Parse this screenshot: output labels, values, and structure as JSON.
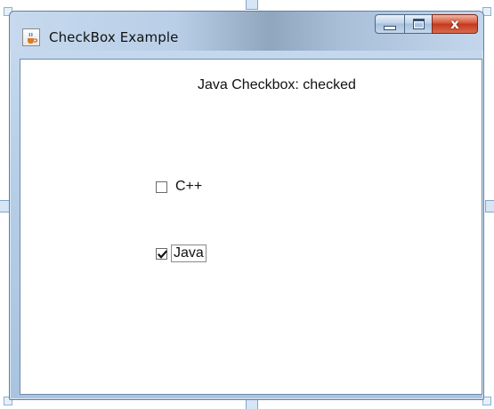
{
  "window": {
    "title": "CheckBox Example",
    "minimize_label": "",
    "maximize_label": "",
    "close_label": "x"
  },
  "status": {
    "text": "Java Checkbox: checked"
  },
  "checkboxes": [
    {
      "label": "C++",
      "checked": false
    },
    {
      "label": "Java",
      "checked": true,
      "focused": true
    }
  ],
  "icons": {
    "app": "java-app-icon",
    "minimize": "minimize-icon",
    "maximize": "maximize-icon",
    "close": "close-icon",
    "check": "checkmark-icon"
  }
}
